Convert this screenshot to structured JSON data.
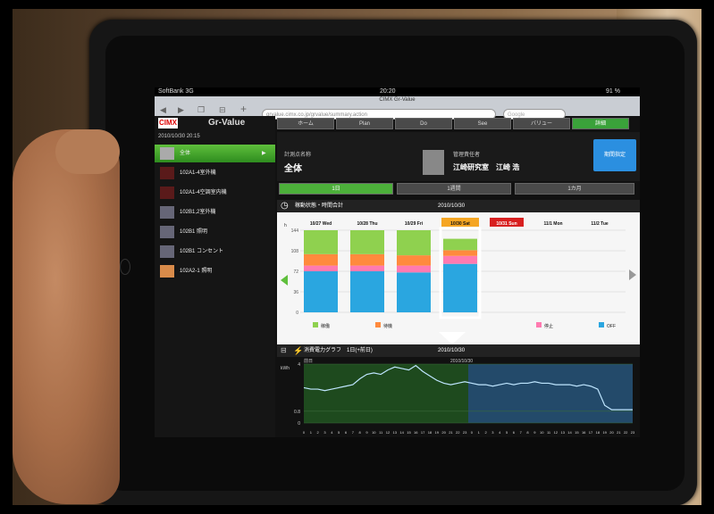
{
  "device": {
    "carrier": "SoftBank 3G",
    "clock": "20:20",
    "page_title": "CIMX Gr-Value",
    "battery": "91 %"
  },
  "browser": {
    "url": "grvalue.cimx.co.jp/grvalue/summary.action",
    "search_placeholder": "Google"
  },
  "app": {
    "logo": "CIMX",
    "name": "Gr-Value",
    "timestamp": "2010/10/30 20:15",
    "nav_tabs": [
      "ホーム",
      "Plan",
      "Do",
      "See",
      "バリュー",
      "詳細"
    ],
    "summary": {
      "label": "計測点名称",
      "value": "全体",
      "manager_label": "管理責任者",
      "manager_value": "江崎研究室　江崎 浩"
    },
    "period_button": "期間指定",
    "ranges": [
      "1日",
      "1週間",
      "1カ月"
    ],
    "sidebar_items": [
      "全体",
      "102A1-4室外機",
      "102A1-4空調室内機",
      "102B1,2室外機",
      "102B1 照明",
      "102B1 コンセント",
      "102A2-1 照明"
    ],
    "status_panel": {
      "title": "稼動状態・時間合計",
      "date": "2010/10/30",
      "day_labels": [
        "10/27 Wed",
        "10/28 Thu",
        "10/29 Fri",
        "10/30 Sat",
        "10/31 Sun",
        "11/1 Mon",
        "11/2 Tue"
      ],
      "unit": "h",
      "legend": [
        "稼働",
        "待機",
        "停止",
        "OFF"
      ]
    },
    "power_panel": {
      "title": "消費電力グラフ　1日(+前日)",
      "date": "2010/10/30",
      "prev_label": "前日",
      "curr_label": "2010/10/30",
      "unit": "kWh"
    }
  },
  "colors": {
    "active_green": "#4caf3a",
    "bar_blue": "#2aa6e0",
    "bar_green": "#8fd14f",
    "bar_orange": "#ff8a3d",
    "bar_pink": "#ff7ab0",
    "highlight_red": "#d82020"
  },
  "chart_data": [
    {
      "type": "bar",
      "title": "稼動状態・時間合計",
      "categories": [
        "10/27 Wed",
        "10/28 Thu",
        "10/29 Fri",
        "10/30 Sat"
      ],
      "ylabel": "h",
      "ylim": [
        0,
        144
      ],
      "yticks": [
        0,
        36,
        72,
        108,
        144
      ],
      "series": [
        {
          "name": "OFF",
          "values": [
            72,
            72,
            70,
            85
          ]
        },
        {
          "name": "停止",
          "values": [
            10,
            10,
            12,
            14
          ]
        },
        {
          "name": "待機",
          "values": [
            20,
            20,
            18,
            10
          ]
        },
        {
          "name": "稼働",
          "values": [
            42,
            42,
            44,
            20
          ]
        }
      ]
    },
    {
      "type": "line",
      "title": "消費電力グラフ　1日(+前日)",
      "ylabel": "kWh",
      "yticks": [
        0,
        0.8,
        4.0
      ],
      "xticks": [
        "0",
        "1",
        "2",
        "3",
        "4",
        "5",
        "6",
        "7",
        "8",
        "9",
        "10",
        "11",
        "12",
        "13",
        "14",
        "15",
        "16",
        "17",
        "18",
        "19",
        "20",
        "21",
        "22",
        "23"
      ],
      "series": [
        {
          "name": "前日",
          "values": [
            2.4,
            2.3,
            2.3,
            2.2,
            2.3,
            2.4,
            2.5,
            2.6,
            3.0,
            3.3,
            3.4,
            3.3,
            3.6,
            3.8,
            3.7,
            3.6,
            3.9,
            3.5,
            3.2,
            2.9,
            2.7,
            2.6,
            2.7,
            2.8
          ]
        },
        {
          "name": "2010/10/30",
          "values": [
            2.7,
            2.6,
            2.6,
            2.5,
            2.6,
            2.7,
            2.6,
            2.7,
            2.7,
            2.8,
            2.7,
            2.7,
            2.6,
            2.6,
            2.6,
            2.5,
            2.6,
            2.5,
            2.3,
            1.2,
            0.9,
            0.9,
            0.9,
            0.9
          ]
        }
      ]
    }
  ]
}
